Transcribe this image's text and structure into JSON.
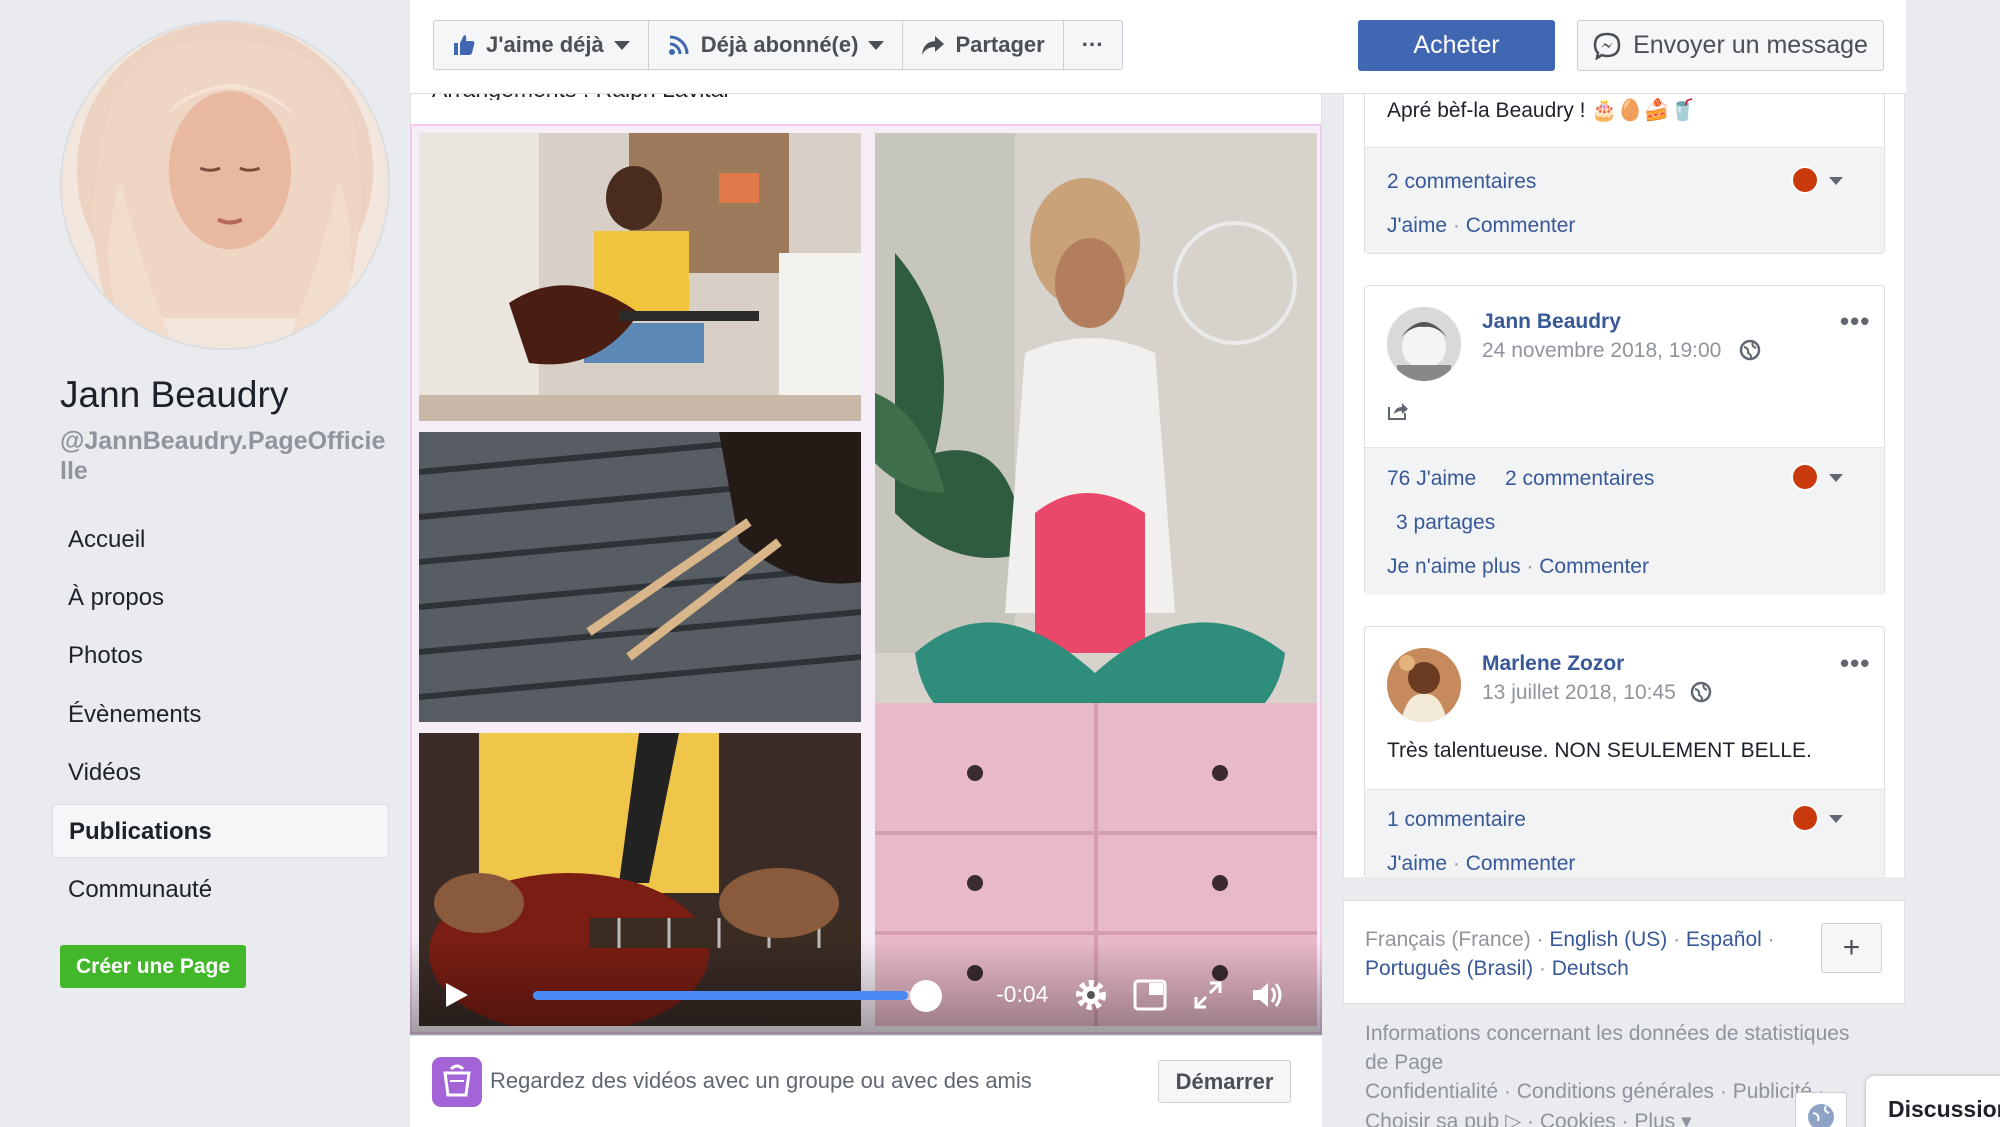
{
  "profile": {
    "name": "Jann Beaudry",
    "handle": "@JannBeaudry.PageOfficielle"
  },
  "nav": {
    "items": [
      {
        "label": "Accueil",
        "active": false
      },
      {
        "label": "À propos",
        "active": false
      },
      {
        "label": "Photos",
        "active": false
      },
      {
        "label": "Évènements",
        "active": false
      },
      {
        "label": "Vidéos",
        "active": false
      },
      {
        "label": "Publications",
        "active": true
      },
      {
        "label": "Communauté",
        "active": false
      }
    ],
    "create_page": "Créer une Page"
  },
  "toolbar": {
    "like": "J'aime déjà",
    "follow": "Déjà abonné(e)",
    "share": "Partager",
    "more": "···",
    "buy": "Acheter",
    "message": "Envoyer un message"
  },
  "post": {
    "caption": "Arrangements : Ralph Lavital"
  },
  "video": {
    "time_remaining": "-0:04",
    "progress": 0.95
  },
  "watch_party": {
    "text": "Regardez des vidéos avec un groupe ou avec des amis",
    "start": "Démarrer"
  },
  "comments": [
    {
      "text": "Apré bèf-la Beaudry ! 🎂🥚🍰🥤",
      "comments_count": "2 commentaires",
      "like_action": "J'aime",
      "comment_action": "Commenter"
    },
    {
      "author": "Jann Beaudry",
      "date": "24 novembre 2018, 19:00",
      "likes": "76 J'aime",
      "comments_count": "2 commentaires",
      "shares": "3 partages",
      "unlike_action": "Je n'aime plus",
      "comment_action": "Commenter"
    },
    {
      "author": "Marlene Zozor",
      "date": "13 juillet 2018, 10:45",
      "text": "Très talentueuse. NON SEULEMENT BELLE.",
      "comments_count": "1 commentaire",
      "like_action": "J'aime",
      "comment_action": "Commenter"
    }
  ],
  "languages": {
    "current": "Français (France)",
    "others": [
      "English (US)",
      "Español",
      "Português (Brasil)",
      "Deutsch"
    ],
    "add": "+"
  },
  "footer": {
    "line1": "Informations concernant les données de statistiques",
    "line2": "de Page",
    "line3": "Confidentialité · Conditions générales · Publicité ·",
    "line4": "Choisir sa pub ▷ · Cookies · Plus ▾"
  },
  "chat": {
    "discussion": "Discussion"
  },
  "colors": {
    "brand_blue": "#4267b2",
    "link": "#385898",
    "green": "#42b72a",
    "progress": "#4a8af4"
  }
}
